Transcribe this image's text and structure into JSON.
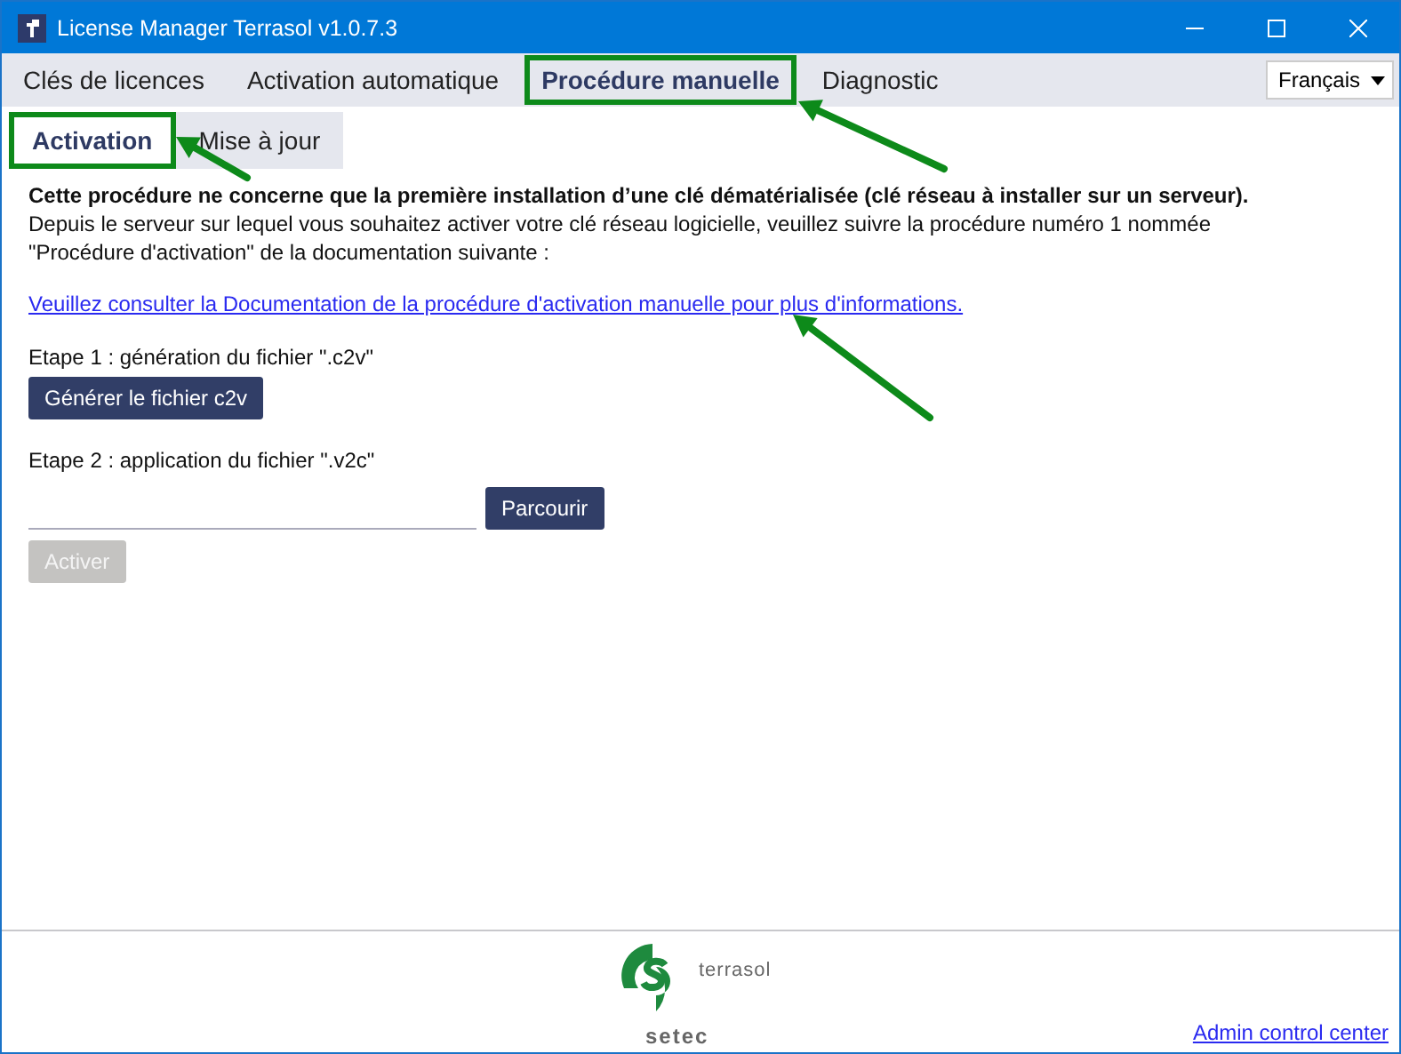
{
  "window": {
    "title": "License Manager Terrasol v1.0.7.3"
  },
  "tabs": [
    {
      "label": "Clés de licences",
      "selected": false,
      "highlighted": false
    },
    {
      "label": "Activation automatique",
      "selected": false,
      "highlighted": false
    },
    {
      "label": "Procédure manuelle",
      "selected": true,
      "highlighted": true
    },
    {
      "label": "Diagnostic",
      "selected": false,
      "highlighted": false
    }
  ],
  "language": {
    "value": "Français"
  },
  "subtabs": [
    {
      "label": "Activation",
      "selected": true,
      "highlighted": true
    },
    {
      "label": "Mise à jour",
      "selected": false,
      "highlighted": false
    }
  ],
  "intro": {
    "heading": "Cette procédure ne concerne que la première installation d’une clé dématérialisée (clé réseau à installer sur un serveur).",
    "text": "Depuis le serveur sur lequel vous souhaitez activer votre clé réseau logicielle, veuillez suivre la procédure numéro 1 nommée \"Procédure d'activation\" de la documentation suivante :"
  },
  "doc_link": "Veuillez consulter la Documentation de la procédure d'activation manuelle pour plus d'informations.",
  "step1": {
    "label": "Etape 1 : génération du fichier \".c2v\"",
    "button": "Générer le fichier c2v"
  },
  "step2": {
    "label": "Etape 2 : application du fichier \".v2c\"",
    "browse_button": "Parcourir"
  },
  "activate_button": {
    "label": "Activer",
    "disabled": true
  },
  "footer": {
    "logo_name": "terrasol",
    "logo_brand": "setec",
    "admin_link": "Admin control center"
  }
}
